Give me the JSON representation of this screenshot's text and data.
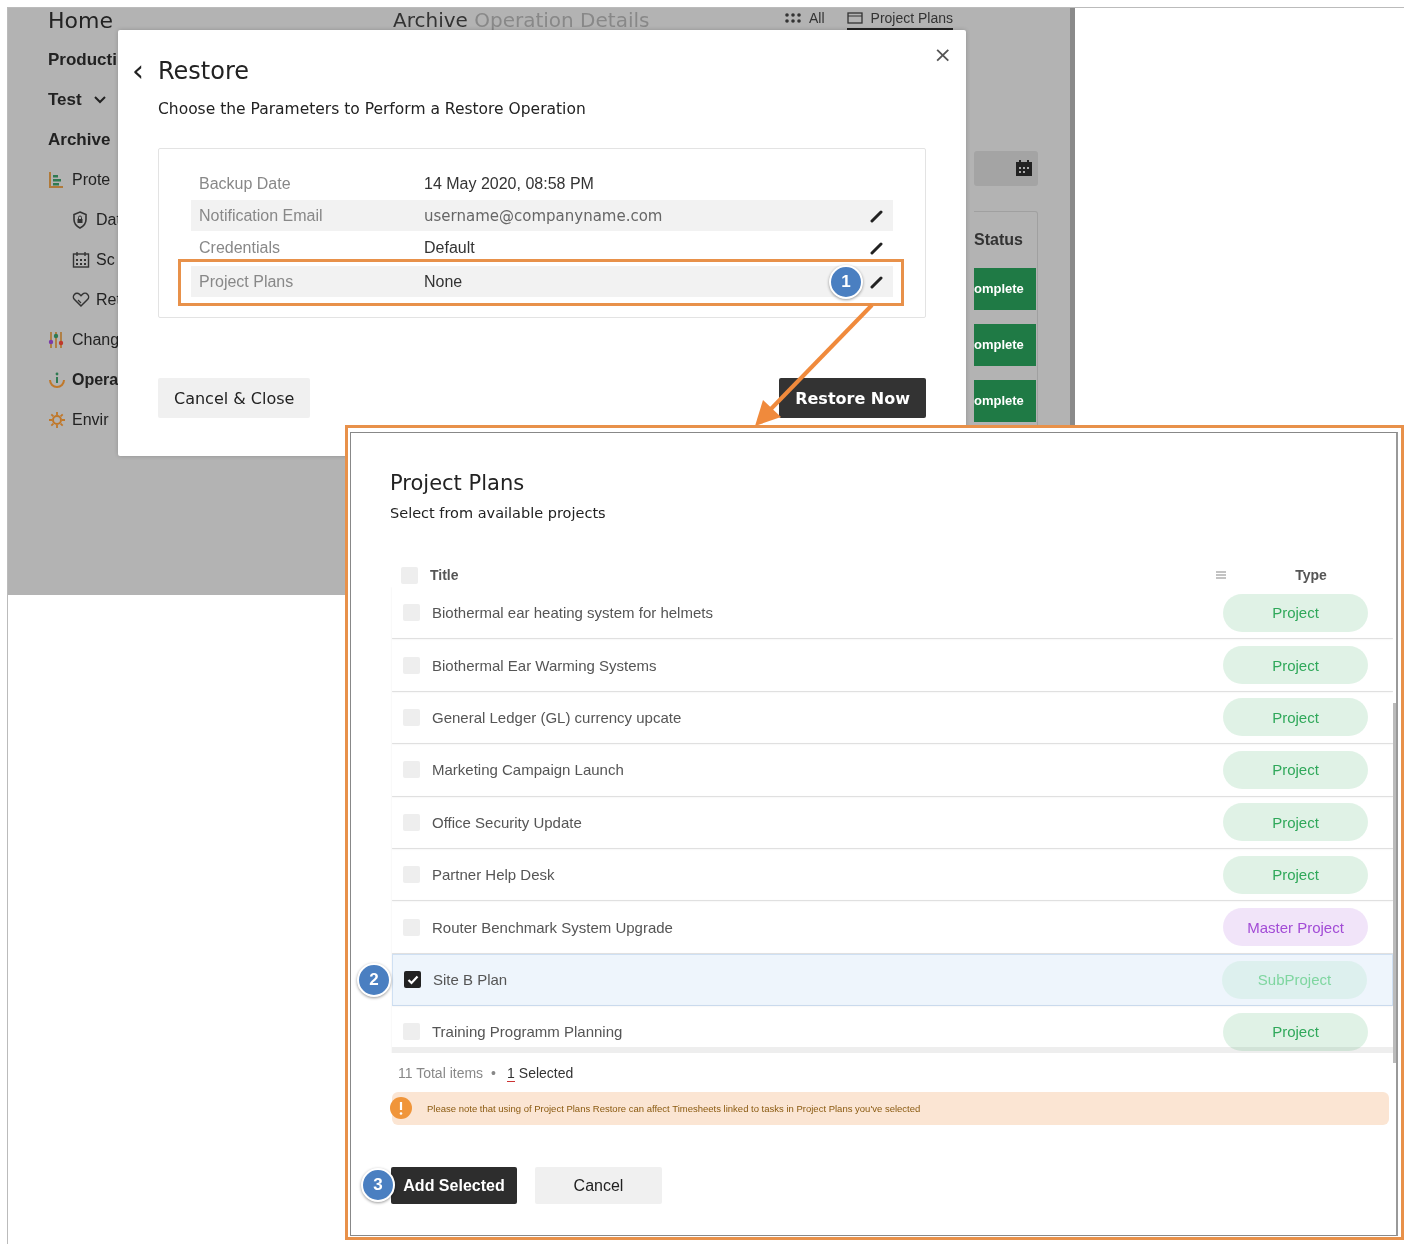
{
  "background": {
    "sidebar": [
      {
        "label": "Home",
        "kind": "title"
      },
      {
        "label": "Producti",
        "kind": "group"
      },
      {
        "label": "Test",
        "kind": "dropdown"
      },
      {
        "label": "Archive",
        "kind": "group"
      },
      {
        "label": "Prote",
        "kind": "section",
        "selected": false
      },
      {
        "label": "Dat",
        "kind": "subsection",
        "selected": false
      },
      {
        "label": "Sc",
        "kind": "subsection",
        "selected": false
      },
      {
        "label": "Ret",
        "kind": "subsection",
        "selected": false
      },
      {
        "label": "Chang",
        "kind": "section",
        "selected": false
      },
      {
        "label": "Opera",
        "kind": "section",
        "selected": true
      },
      {
        "label": "Envir",
        "kind": "section",
        "selected": false
      }
    ],
    "title": "Archive",
    "subtitle": "Operation Details",
    "tabs": [
      {
        "label": "All",
        "selected": false
      },
      {
        "label": "Project Plans",
        "selected": true
      }
    ],
    "status_column": "Status",
    "status_badges": [
      "omplete",
      "omplete",
      "omplete"
    ]
  },
  "restore_dialog": {
    "back": "‹",
    "title": "Restore",
    "close": "×",
    "subtitle": "Choose the Parameters to Perform a Restore Operation",
    "parameters": [
      {
        "label": "Backup Date",
        "value": "14 May 2020, 08:58 PM",
        "editable": false
      },
      {
        "label": "Notification Email",
        "value": "username@companyname.com",
        "editable": true
      },
      {
        "label": "Credentials",
        "value": "Default",
        "editable": true
      },
      {
        "label": "Project Plans",
        "value": "None",
        "editable": true,
        "step": "1"
      }
    ],
    "buttons": [
      "Cancel & Close",
      "Restore Now"
    ]
  },
  "project_plans": {
    "title": "Project Plans",
    "subtitle": "Select from available projects",
    "select_all": {
      "checked": false
    },
    "columns": [
      "Title",
      "Type"
    ],
    "rows": [
      {
        "title": "Biothermal ear heating system for helmets",
        "type": "Project",
        "color": "#2fa85a",
        "checked": false
      },
      {
        "title": "Biothermal Ear Warming Systems",
        "type": "Project",
        "color": "#2fa85a",
        "checked": false
      },
      {
        "title": "General Ledger (GL) currency upcate",
        "type": "Project",
        "color": "#2fa85a",
        "checked": false
      },
      {
        "title": "Marketing Campaign Launch",
        "type": "Project",
        "color": "#2fa85a",
        "checked": false
      },
      {
        "title": "Office Security Update",
        "type": "Project",
        "color": "#2fa85a",
        "checked": false
      },
      {
        "title": "Partner Help Desk",
        "type": "Project",
        "color": "#2fa85a",
        "checked": false
      },
      {
        "title": "Router Benchmark System Upgrade",
        "type": "Master Project",
        "color": "#a24bd6",
        "checked": false
      },
      {
        "title": "Site B Plan",
        "type": "SubProject",
        "color": "#7fd6a0",
        "checked": true,
        "step": "2"
      },
      {
        "title": "Training Programm Planning",
        "type": "Project",
        "color": "#2fa85a",
        "checked": false
      }
    ],
    "total": "11 Total items",
    "separator": "•",
    "selected_count": "1",
    "selected_label": "Selected",
    "notice": "Please note that using of Project Plans Restore can affect Timesheets linked to tasks in Project Plans you've selected",
    "buttons": [
      {
        "label": "Add Selected",
        "step": "3"
      },
      {
        "label": "Cancel"
      }
    ]
  }
}
